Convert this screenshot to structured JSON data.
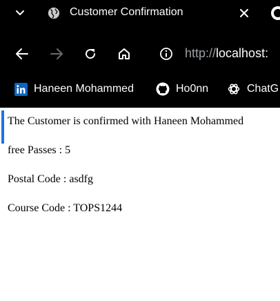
{
  "tab": {
    "title": "Customer Confirmation",
    "favicon": "globe-icon"
  },
  "navbar": {
    "url_protocol": "http://",
    "url_host": "localhost:"
  },
  "bookmarks": [
    {
      "label": "Haneen Mohammed",
      "icon": "linkedin-icon"
    },
    {
      "label": "Ho0nn",
      "icon": "github-icon"
    },
    {
      "label": "ChatG",
      "icon": "chatgpt-icon"
    }
  ],
  "page": {
    "line1": "The Customer is confirmed with Haneen Mohammed",
    "line2": "free Passes : 5",
    "line3": "Postal Code : asdfg",
    "line4": "Course Code : TOPS1244"
  },
  "colors": {
    "chrome_bg": "#000000",
    "chrome_text": "#ffffff",
    "url_dim": "#9aa0a6",
    "focus_accent": "#1a73e8",
    "linkedin_blue": "#0a66c2"
  }
}
